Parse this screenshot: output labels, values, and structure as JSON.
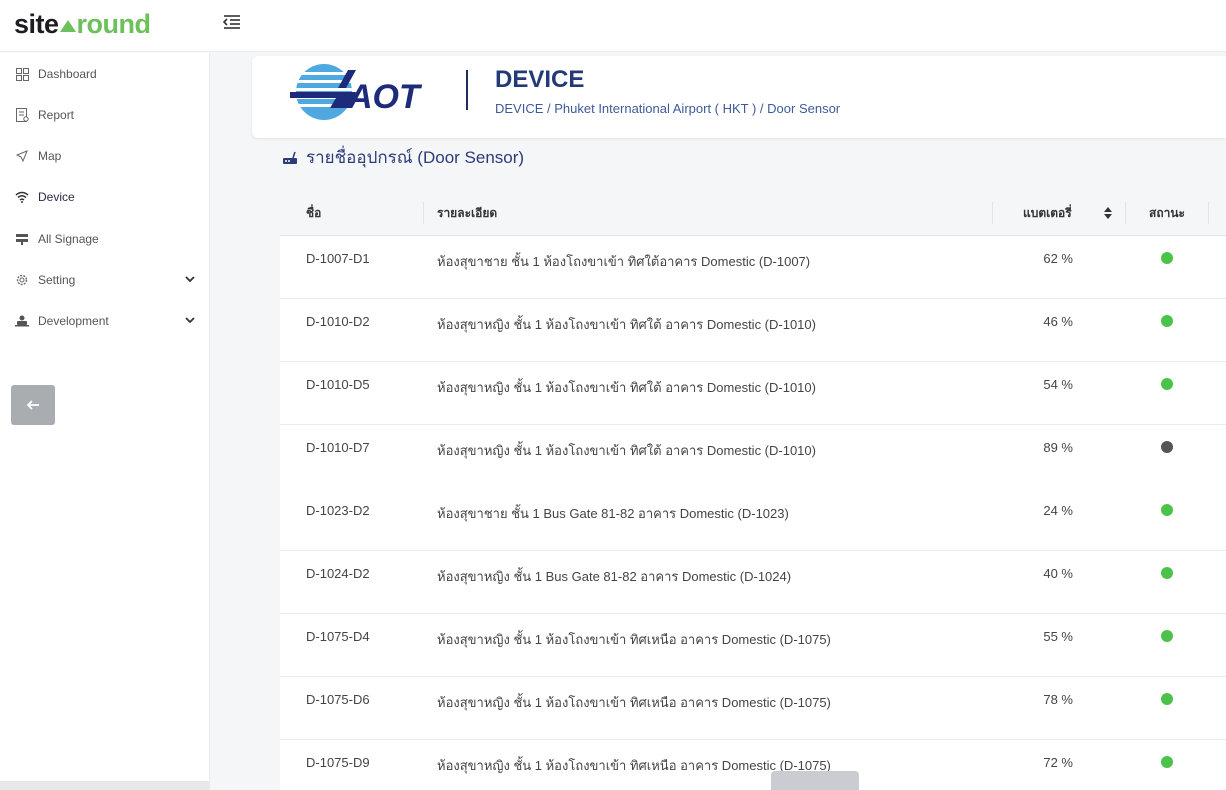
{
  "brand": {
    "part1": "site",
    "part2": "round"
  },
  "sidebar": {
    "items": [
      {
        "label": "Dashboard",
        "icon": "grid-icon"
      },
      {
        "label": "Report",
        "icon": "report-icon"
      },
      {
        "label": "Map",
        "icon": "send-icon"
      },
      {
        "label": "Device",
        "icon": "wifi-icon"
      },
      {
        "label": "All Signage",
        "icon": "signage-icon"
      },
      {
        "label": "Setting",
        "icon": "gear-icon"
      },
      {
        "label": "Development",
        "icon": "developer-icon"
      }
    ]
  },
  "header": {
    "logo_text": "AOT",
    "title": "DEVICE",
    "breadcrumb": "DEVICE / Phuket International Airport ( HKT ) / Door Sensor"
  },
  "section": {
    "title": "รายชื่ออุปกรณ์ (Door Sensor)"
  },
  "table": {
    "columns": [
      "ชื่อ",
      "รายละเอียด",
      "แบตเตอรี่",
      "สถานะ"
    ],
    "rows": [
      {
        "name": "D-1007-D1",
        "detail": "ห้องสุขาชาย ชั้น 1 ห้องโถงขาเข้า ทิศใต้อาคาร Domestic (D-1007)",
        "battery": "62 %",
        "status": "online"
      },
      {
        "name": "D-1010-D2",
        "detail": "ห้องสุขาหญิง ชั้น 1 ห้องโถงขาเข้า ทิศใต้ อาคาร Domestic (D-1010)",
        "battery": "46 %",
        "status": "online"
      },
      {
        "name": "D-1010-D5",
        "detail": "ห้องสุขาหญิง ชั้น 1 ห้องโถงขาเข้า ทิศใต้ อาคาร Domestic (D-1010)",
        "battery": "54 %",
        "status": "online"
      },
      {
        "name": "D-1010-D7",
        "detail": "ห้องสุขาหญิง ชั้น 1 ห้องโถงขาเข้า ทิศใต้ อาคาร Domestic (D-1010)",
        "battery": "89 %",
        "status": "offline"
      },
      {
        "name": "D-1023-D2",
        "detail": "ห้องสุขาชาย ชั้น 1 Bus Gate 81-82 อาคาร Domestic (D-1023)",
        "battery": "24 %",
        "status": "online"
      },
      {
        "name": "D-1024-D2",
        "detail": "ห้องสุขาหญิง ชั้น 1 Bus Gate 81-82 อาคาร Domestic (D-1024)",
        "battery": "40 %",
        "status": "online"
      },
      {
        "name": "D-1075-D4",
        "detail": "ห้องสุขาหญิง ชั้น 1 ห้องโถงขาเข้า ทิศเหนือ อาคาร Domestic (D-1075)",
        "battery": "55 %",
        "status": "online"
      },
      {
        "name": "D-1075-D6",
        "detail": "ห้องสุขาหญิง ชั้น 1 ห้องโถงขาเข้า ทิศเหนือ อาคาร Domestic (D-1075)",
        "battery": "78 %",
        "status": "online"
      },
      {
        "name": "D-1075-D9",
        "detail": "ห้องสุขาหญิง ชั้น 1 ห้องโถงขาเข้า ทิศเหนือ อาคาร Domestic (D-1075)",
        "battery": "72 %",
        "status": "online"
      }
    ]
  },
  "colors": {
    "online": "#4cc24a",
    "offline": "#555555",
    "accent": "#243a78",
    "brand_green": "#6cc15a"
  }
}
